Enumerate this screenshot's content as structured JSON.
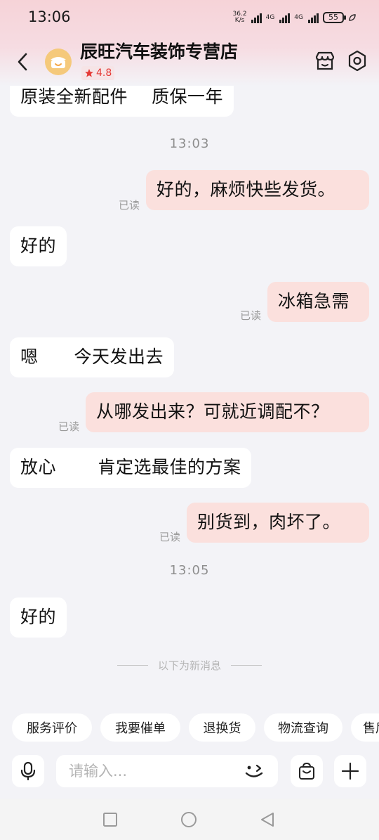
{
  "status_bar": {
    "time": "13:06",
    "net_speed_value": "36.2",
    "net_speed_unit": "K/s",
    "network_1": "4G",
    "network_2": "4G",
    "battery": "55"
  },
  "header": {
    "store_name": "辰旺汽车装饰专营店",
    "rating": "4.8"
  },
  "messages": [
    {
      "side": "in",
      "text": "原装全新配件　 质保一年"
    },
    {
      "type": "timestamp",
      "text": "13:03"
    },
    {
      "side": "out",
      "text": "好的，麻烦快些发货。",
      "status": "已读"
    },
    {
      "side": "in",
      "text": "好的"
    },
    {
      "side": "out",
      "text": "冰箱急需",
      "status": "已读"
    },
    {
      "side": "in",
      "text": "嗯　　今天发出去"
    },
    {
      "side": "out",
      "text": "从哪发出来？可就近调配不？",
      "status": "已读"
    },
    {
      "side": "in",
      "text": "放心　　 肯定选最佳的方案"
    },
    {
      "side": "out",
      "text": "别货到，肉坏了。",
      "status": "已读"
    },
    {
      "type": "timestamp",
      "text": "13:05"
    },
    {
      "side": "in",
      "text": "好的"
    }
  ],
  "new_messages_divider": "以下为新消息",
  "quick_actions": [
    "服务评价",
    "我要催单",
    "退换货",
    "物流查询",
    "售后"
  ],
  "input": {
    "placeholder": "请输入..."
  },
  "colors": {
    "header_tint": "#f6d3d8",
    "outgoing_bubble": "#fbe0dd",
    "incoming_bubble": "#ffffff",
    "rating_red": "#e53935",
    "background": "#f3f3f7"
  }
}
